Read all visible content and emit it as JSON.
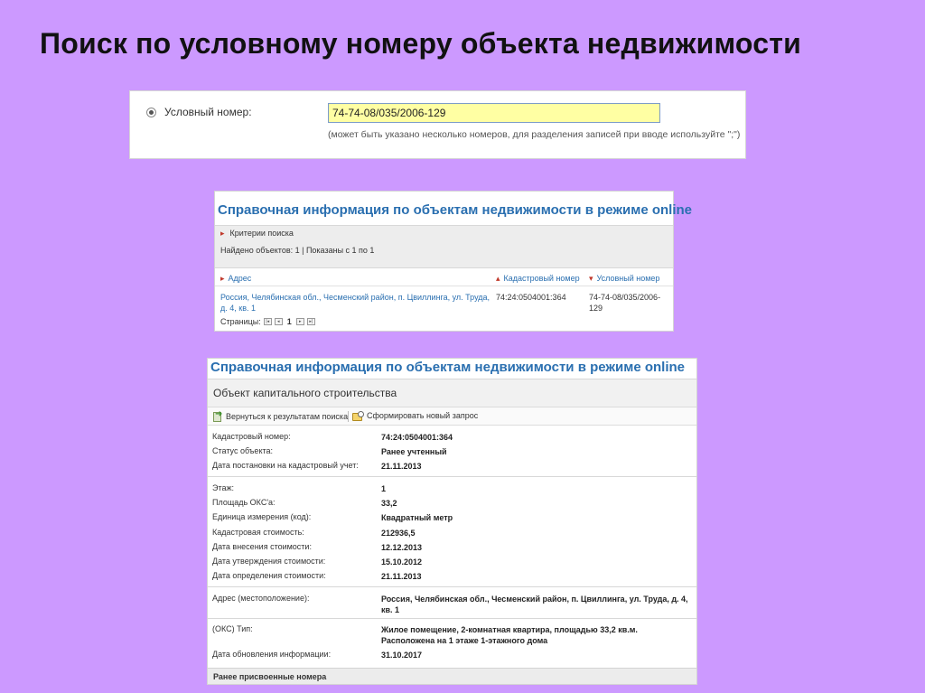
{
  "slide": {
    "title": "Поиск по условному номеру объекта недвижимости"
  },
  "search_panel": {
    "label": "Условный номер:",
    "value": "74-74-08/035/2006-129",
    "hint": "(может быть указано несколько номеров, для разделения записей при вводе используйте \";\")"
  },
  "results_panel": {
    "header": "Справочная информация по объектам недвижимости в режиме online",
    "criteria_label": "Критерии поиска",
    "found_text": "Найдено объектов: 1 | Показаны с 1 по 1",
    "columns": {
      "address": "Адрес",
      "cadastral": "Кадастровый номер",
      "conditional": "Условный номер"
    },
    "row": {
      "address": "Россия, Челябинская обл., Чесменский район, п. Цвиллинга, ул. Труда, д. 4, кв. 1",
      "cadastral": "74:24:0504001:364",
      "conditional": "74-74-08/035/2006-129"
    },
    "pager": {
      "label": "Страницы:",
      "current": "1"
    }
  },
  "details_panel": {
    "header": "Справочная информация по объектам недвижимости в режиме online",
    "subheader": "Объект капитального строительства",
    "toolbar": {
      "back": "Вернуться к результатам поиска",
      "new_request": "Сформировать новый запрос"
    },
    "fields": [
      {
        "key": "Кадастровый номер:",
        "value": "74:24:0504001:364"
      },
      {
        "key": "Статус объекта:",
        "value": "Ранее учтенный"
      },
      {
        "key": "Дата постановки на кадастровый учет:",
        "value": "21.11.2013"
      },
      {
        "key": "Этаж:",
        "value": "1"
      },
      {
        "key": "Площадь ОКС'а:",
        "value": "33,2"
      },
      {
        "key": "Единица измерения (код):",
        "value": "Квадратный метр"
      },
      {
        "key": "Кадастровая стоимость:",
        "value": "212936,5"
      },
      {
        "key": "Дата внесения стоимости:",
        "value": "12.12.2013"
      },
      {
        "key": "Дата утверждения стоимости:",
        "value": "15.10.2012"
      },
      {
        "key": "Дата определения стоимости:",
        "value": "21.11.2013"
      },
      {
        "key": "Адрес (местоположение):",
        "value": "Россия, Челябинская обл., Чесменский район, п. Цвиллинга, ул. Труда, д. 4, кв. 1"
      },
      {
        "key": "(ОКС) Тип:",
        "value": "Жилое помещение, 2-комнатная квартира, площадью 33,2 кв.м. Расположена на 1 этаже 1-этажного дома"
      },
      {
        "key": "Дата обновления информации:",
        "value": "31.10.2017"
      }
    ],
    "footer": "Ранее присвоенные номера"
  }
}
